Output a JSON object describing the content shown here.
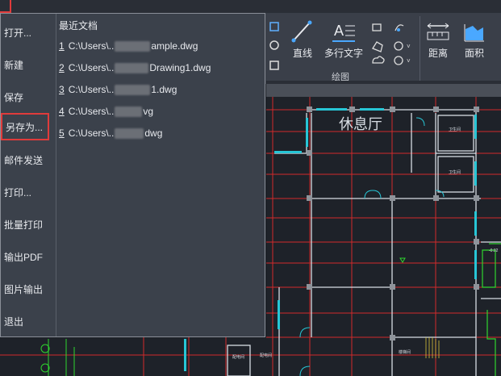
{
  "ribbon": {
    "panel_label": "绘图",
    "buttons": [
      {
        "label": "直线",
        "icon": "line-icon"
      },
      {
        "label": "多行文字",
        "icon": "multiline-text-icon"
      },
      {
        "label": "距离",
        "icon": "distance-icon"
      },
      {
        "label": "面积",
        "icon": "area-icon"
      }
    ]
  },
  "menu": {
    "items": [
      "打开...",
      "新建",
      "保存",
      "另存为...",
      "邮件发送",
      "打印...",
      "批量打印",
      "输出PDF",
      "图片输出",
      "退出"
    ],
    "recent_title": "最近文档",
    "recent": [
      {
        "num": "1",
        "prefix": "C:\\Users\\..",
        "suffix": "ample.dwg"
      },
      {
        "num": "2",
        "prefix": "C:\\Users\\..",
        "suffix": "Drawing1.dwg"
      },
      {
        "num": "3",
        "prefix": "C:\\Users\\..",
        "suffix": "1.dwg"
      },
      {
        "num": "4",
        "prefix": "C:\\Users\\..",
        "suffix": "vg"
      },
      {
        "num": "5",
        "prefix": "C:\\Users\\..",
        "suffix": "dwg"
      }
    ]
  },
  "drawing": {
    "room_label": "休息厅",
    "tags": [
      "卫生间",
      "卫生间",
      "-0.02",
      "楼梯间",
      "配电间",
      "配电间"
    ]
  },
  "colors": {
    "accent_red": "#e03b3b",
    "grid_red": "#d22a2a",
    "wall_white": "#d8dde4",
    "window_cyan": "#27c6d6",
    "green": "#2fd52f"
  }
}
